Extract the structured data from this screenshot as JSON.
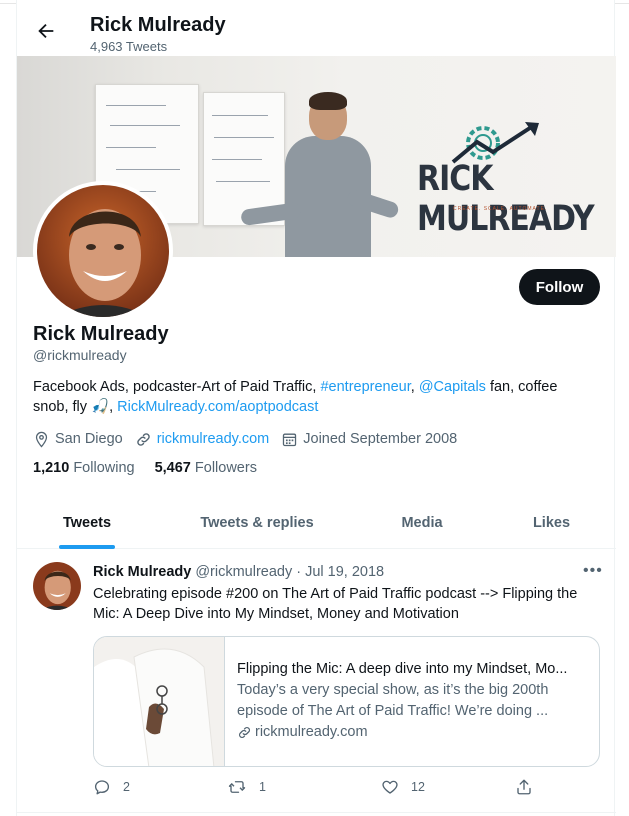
{
  "header": {
    "name": "Rick Mulready",
    "tweet_count": "4,963 Tweets"
  },
  "banner": {
    "logo_text": "RICK MULREADY",
    "logo_tagline": "CREATE. SCALE. AUTOMATE."
  },
  "profile": {
    "follow_label": "Follow",
    "name": "Rick Mulready",
    "handle": "@rickmulready",
    "bio": {
      "part1": "Facebook Ads, podcaster-Art of Paid Traffic, ",
      "hashtag": "#entrepreneur",
      "sep1": ", ",
      "mention": "@Capitals",
      "part2": " fan, coffee snob, fly ",
      "emoji": "🎣",
      "sep2": ", ",
      "link": "RickMulready.com/aoptpodcast"
    },
    "location": "San Diego",
    "website": "rickmulready.com",
    "joined": "Joined September 2008",
    "following_count": "1,210",
    "following_label": "Following",
    "followers_count": "5,467",
    "followers_label": "Followers"
  },
  "tabs": [
    {
      "label": "Tweets",
      "active": true
    },
    {
      "label": "Tweets & replies",
      "active": false
    },
    {
      "label": "Media",
      "active": false
    },
    {
      "label": "Likes",
      "active": false
    }
  ],
  "tweet": {
    "author": "Rick Mulready",
    "handle": "@rickmulready",
    "separator": "·",
    "date": "Jul 19, 2018",
    "text": "Celebrating episode #200 on The Art of Paid Traffic podcast --> Flipping the Mic: A Deep Dive into My Mindset, Money and Motivation",
    "card": {
      "title": "Flipping the Mic: A deep dive into my Mindset, Mo...",
      "description": "Today’s a very special show, as it’s the big 200th episode of The Art of Paid Traffic! We’re doing ...",
      "domain": "rickmulready.com"
    },
    "replies": "2",
    "retweets": "1",
    "likes": "12"
  },
  "colors": {
    "accent": "#1d9bf0",
    "text": "#0f1419",
    "muted": "#536471",
    "follow_bg": "#0f1419"
  }
}
